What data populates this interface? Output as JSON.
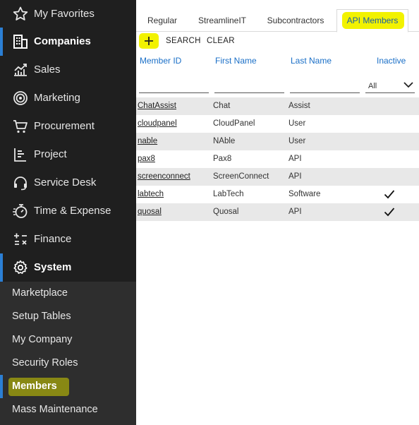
{
  "sidebar": {
    "items": [
      {
        "label": "My Favorites",
        "icon": "star-icon"
      },
      {
        "label": "Companies",
        "icon": "building-icon"
      },
      {
        "label": "Sales",
        "icon": "chart-trend-icon"
      },
      {
        "label": "Marketing",
        "icon": "target-icon"
      },
      {
        "label": "Procurement",
        "icon": "cart-icon"
      },
      {
        "label": "Project",
        "icon": "project-icon"
      },
      {
        "label": "Service Desk",
        "icon": "headset-icon"
      },
      {
        "label": "Time & Expense",
        "icon": "stopwatch-icon"
      },
      {
        "label": "Finance",
        "icon": "calculator-icon"
      },
      {
        "label": "System",
        "icon": "gear-icon"
      }
    ],
    "sub_items": [
      {
        "label": "Marketplace"
      },
      {
        "label": "Setup Tables"
      },
      {
        "label": "My Company"
      },
      {
        "label": "Security Roles"
      },
      {
        "label": "Members"
      },
      {
        "label": "Mass Maintenance"
      }
    ]
  },
  "tabs": [
    {
      "label": "Regular"
    },
    {
      "label": "StreamlineIT"
    },
    {
      "label": "Subcontractors"
    },
    {
      "label": "API Members"
    }
  ],
  "toolbar": {
    "add_icon": "plus-icon",
    "search_label": "SEARCH",
    "clear_label": "CLEAR"
  },
  "table": {
    "columns": [
      "Member ID",
      "First Name",
      "Last Name",
      "Inactive"
    ],
    "filter_inactive": "All",
    "rows": [
      {
        "member_id": "ChatAssist",
        "first": "Chat",
        "last": "Assist",
        "inactive": false
      },
      {
        "member_id": "cloudpanel",
        "first": "CloudPanel",
        "last": "User",
        "inactive": false
      },
      {
        "member_id": "nable",
        "first": "NAble",
        "last": "User",
        "inactive": false
      },
      {
        "member_id": "pax8",
        "first": "Pax8",
        "last": "API",
        "inactive": false
      },
      {
        "member_id": "screenconnect",
        "first": "ScreenConnect",
        "last": "API",
        "inactive": false
      },
      {
        "member_id": "labtech",
        "first": "LabTech",
        "last": "Software",
        "inactive": true
      },
      {
        "member_id": "quosal",
        "first": "Quosal",
        "last": "API",
        "inactive": true
      }
    ]
  },
  "colors": {
    "accent": "#2b7fd4",
    "highlight": "#f2f200",
    "sidebar_bg": "#1f1f1f",
    "link_blue": "#1a6fc7"
  }
}
